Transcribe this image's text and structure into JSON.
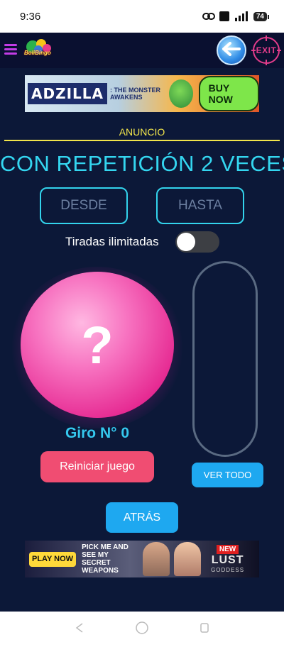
{
  "status_bar": {
    "time": "9:36",
    "network": "4G",
    "volte": "Vo LTE",
    "battery": "74"
  },
  "app_bar": {
    "logo_text": "BoliBingo",
    "logo_letter": "B",
    "exit_label": "EXIT"
  },
  "ad_top": {
    "brand": "ADZILLA",
    "tagline": ": THE MONSTER AWAKENS",
    "cta": "BUY NOW"
  },
  "ad_label": "ANUNCIO",
  "mode_title": "CON REPETICIÓN 2 VECES",
  "range": {
    "from_placeholder": "DESDE",
    "to_placeholder": "HASTA"
  },
  "unlimited": {
    "label": "Tiradas ilimitadas",
    "enabled": false
  },
  "ball": {
    "symbol": "?"
  },
  "spin": {
    "label": "Giro N° 0"
  },
  "buttons": {
    "reset": "Reiniciar juego",
    "view_all": "VER TODO",
    "back": "ATRÁS"
  },
  "ad_bottom": {
    "play_now": "PLAY NOW",
    "pitch": "PICK ME AND SEE MY SECRET WEAPONS",
    "badge": "NEW",
    "game": "LUST",
    "game_sub": "GODDESS"
  },
  "colors": {
    "accent": "#34d6f0",
    "ball": "#e62a92",
    "reset": "#f04d72",
    "button": "#1ea8f0",
    "ad_label": "#f2e54b"
  }
}
